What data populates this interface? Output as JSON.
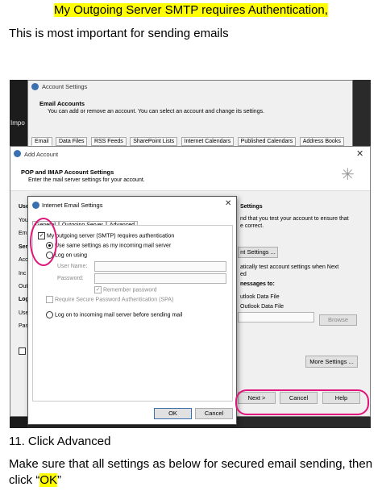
{
  "doc": {
    "heading": "My Outgoing Server SMTP requires Authentication,",
    "intro": "This is most important for sending emails",
    "step": "11. Click Advanced",
    "note_prefix": "Make sure that all settings as below for secured email sending, then click “",
    "note_ok": "OK",
    "note_suffix": "”"
  },
  "account_settings": {
    "title": "Account Settings",
    "section_title": "Email Accounts",
    "section_desc": "You can add or remove an account. You can select an account and change its settings.",
    "tabs": [
      "Email",
      "Data Files",
      "RSS Feeds",
      "SharePoint Lists",
      "Internet Calendars",
      "Published Calendars",
      "Address Books"
    ],
    "left_fragment": "Impo"
  },
  "add_account": {
    "title": "Add Account",
    "header": "POP and IMAP Account Settings",
    "subheader": "Enter the mail server settings for your account.",
    "left_labels": [
      "Use",
      "Your",
      "Em",
      "Ser",
      "Acc",
      "Inc",
      "Out",
      "Log",
      "Use",
      "Pas"
    ],
    "right_heading": "Settings",
    "right_text1": "nd that you test your account to ensure that",
    "right_text2": "e correct.",
    "test_button": "nt Settings ...",
    "right_text3": "atically test account settings when Next",
    "right_text4": "ed",
    "messages_to": "nessages to:",
    "new_data_file": "utlook Data File",
    "existing_data_file": "Outlook Data File",
    "browse": "Browse",
    "more_settings": "More Settings ...",
    "next": "Next >",
    "cancel": "Cancel",
    "help": "Help"
  },
  "internet_email": {
    "title": "Internet Email Settings",
    "tabs": [
      "General",
      "Outgoing Server",
      "Advanced"
    ],
    "requires_auth": "My outgoing server (SMTP) requires authentication",
    "use_same": "Use same settings as my incoming mail server",
    "log_on_using": "Log on using",
    "user_name_label": "User Name:",
    "password_label": "Password:",
    "remember_password": "Remember password",
    "spa": "Require Secure Password Authentication (SPA)",
    "log_on_incoming": "Log on to incoming mail server before sending mail",
    "ok": "OK",
    "cancel": "Cancel"
  },
  "colors": {
    "highlight": "#ffff00",
    "annotation": "#e0147a",
    "screenshot_bg": "#2a2a2a"
  }
}
